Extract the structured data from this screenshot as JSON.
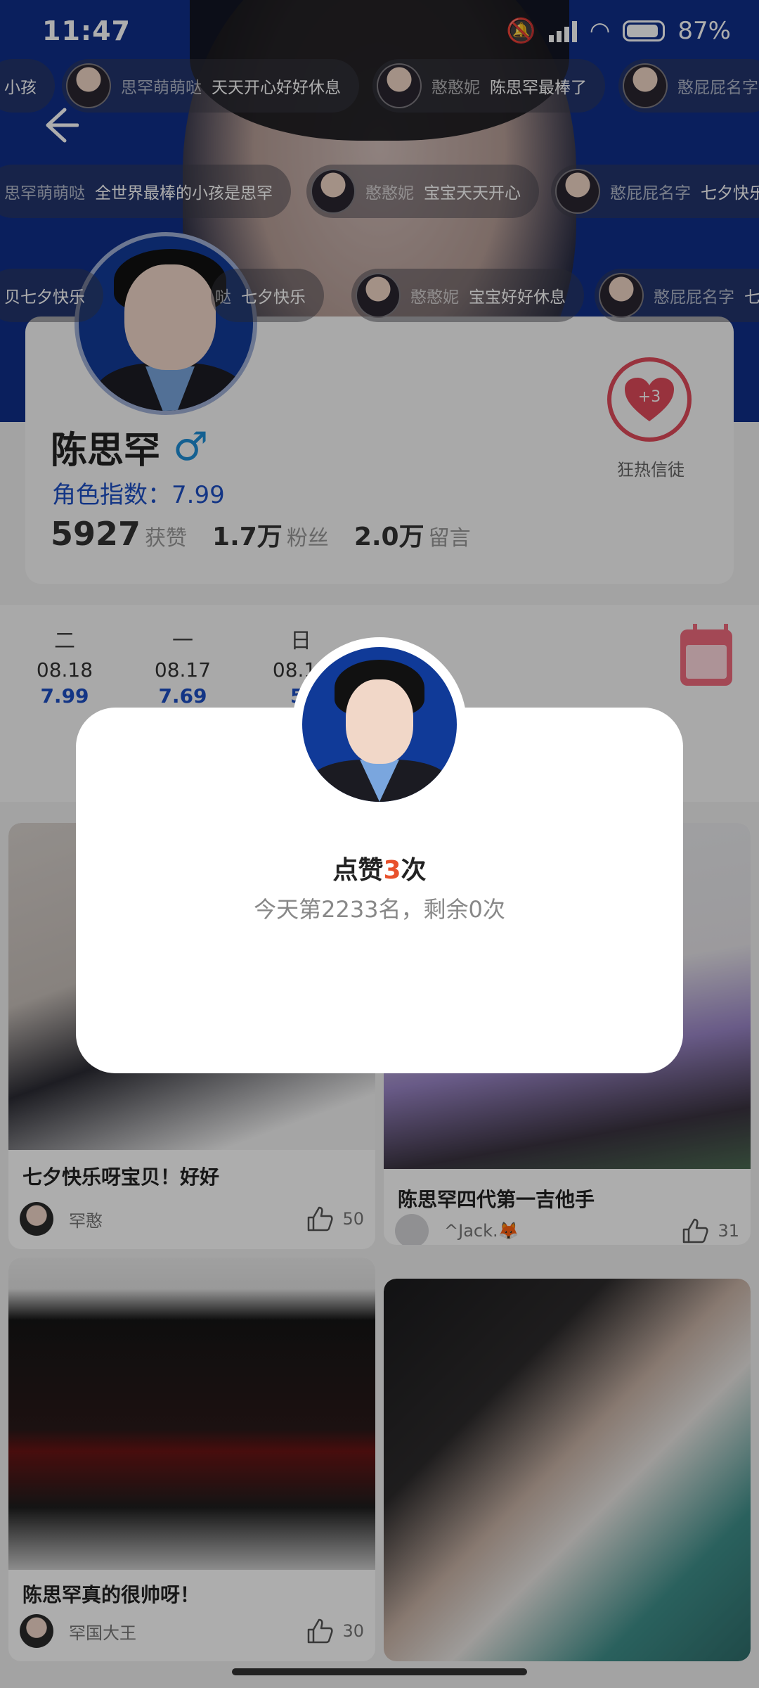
{
  "status": {
    "time": "11:47",
    "battery": "87%"
  },
  "danmaku": {
    "row1": [
      {
        "nick": "",
        "text": "小孩"
      },
      {
        "nick": "思罕萌萌哒",
        "text": "天天开心好好休息"
      },
      {
        "nick": "憨憨妮",
        "text": "陈思罕最棒了"
      },
      {
        "nick": "憨屁屁名字",
        "text": ""
      }
    ],
    "row2": [
      {
        "nick": "思罕萌萌哒",
        "text": "全世界最棒的小孩是思罕"
      },
      {
        "nick": "憨憨妮",
        "text": "宝宝天天开心"
      },
      {
        "nick": "憨屁屁名字",
        "text": "七夕快乐"
      }
    ],
    "row3": [
      {
        "nick": "",
        "text": "贝七夕快乐"
      },
      {
        "nick": "哒",
        "text": "七夕快乐"
      },
      {
        "nick": "憨憨妮",
        "text": "宝宝好好休息"
      },
      {
        "nick": "憨屁屁名字",
        "text": "七夕快乐"
      }
    ]
  },
  "profile": {
    "name": "陈思罕",
    "gender_symbol": "♂",
    "index_label": "角色指数：7.99",
    "likes_num": "5927",
    "likes_label": "获赞",
    "fans_num": "1.7万",
    "fans_label": "粉丝",
    "msgs_num": "2.0万",
    "msgs_label": "留言",
    "fan_badge_plus": "+3",
    "fan_badge_label": "狂热信徒"
  },
  "dates": [
    {
      "weekday": "二",
      "date": "08.18",
      "value": "7.99"
    },
    {
      "weekday": "一",
      "date": "08.17",
      "value": "7.69"
    },
    {
      "weekday": "日",
      "date": "08.16",
      "value": "5."
    }
  ],
  "posts": [
    {
      "title": "七夕快乐呀宝贝！好好",
      "author": "罕憨",
      "likes": "50"
    },
    {
      "title": "陈思罕四代第一吉他手",
      "author": "^Jack.🦊",
      "likes": "31"
    },
    {
      "title": "陈思罕真的很帅呀！",
      "author": "罕国大王",
      "likes": "30"
    },
    {
      "title": "",
      "author": "",
      "likes": ""
    }
  ],
  "modal": {
    "title_prefix": "点赞",
    "count": "3",
    "title_suffix": "次",
    "subtitle": "今天第2233名，剩余0次"
  }
}
